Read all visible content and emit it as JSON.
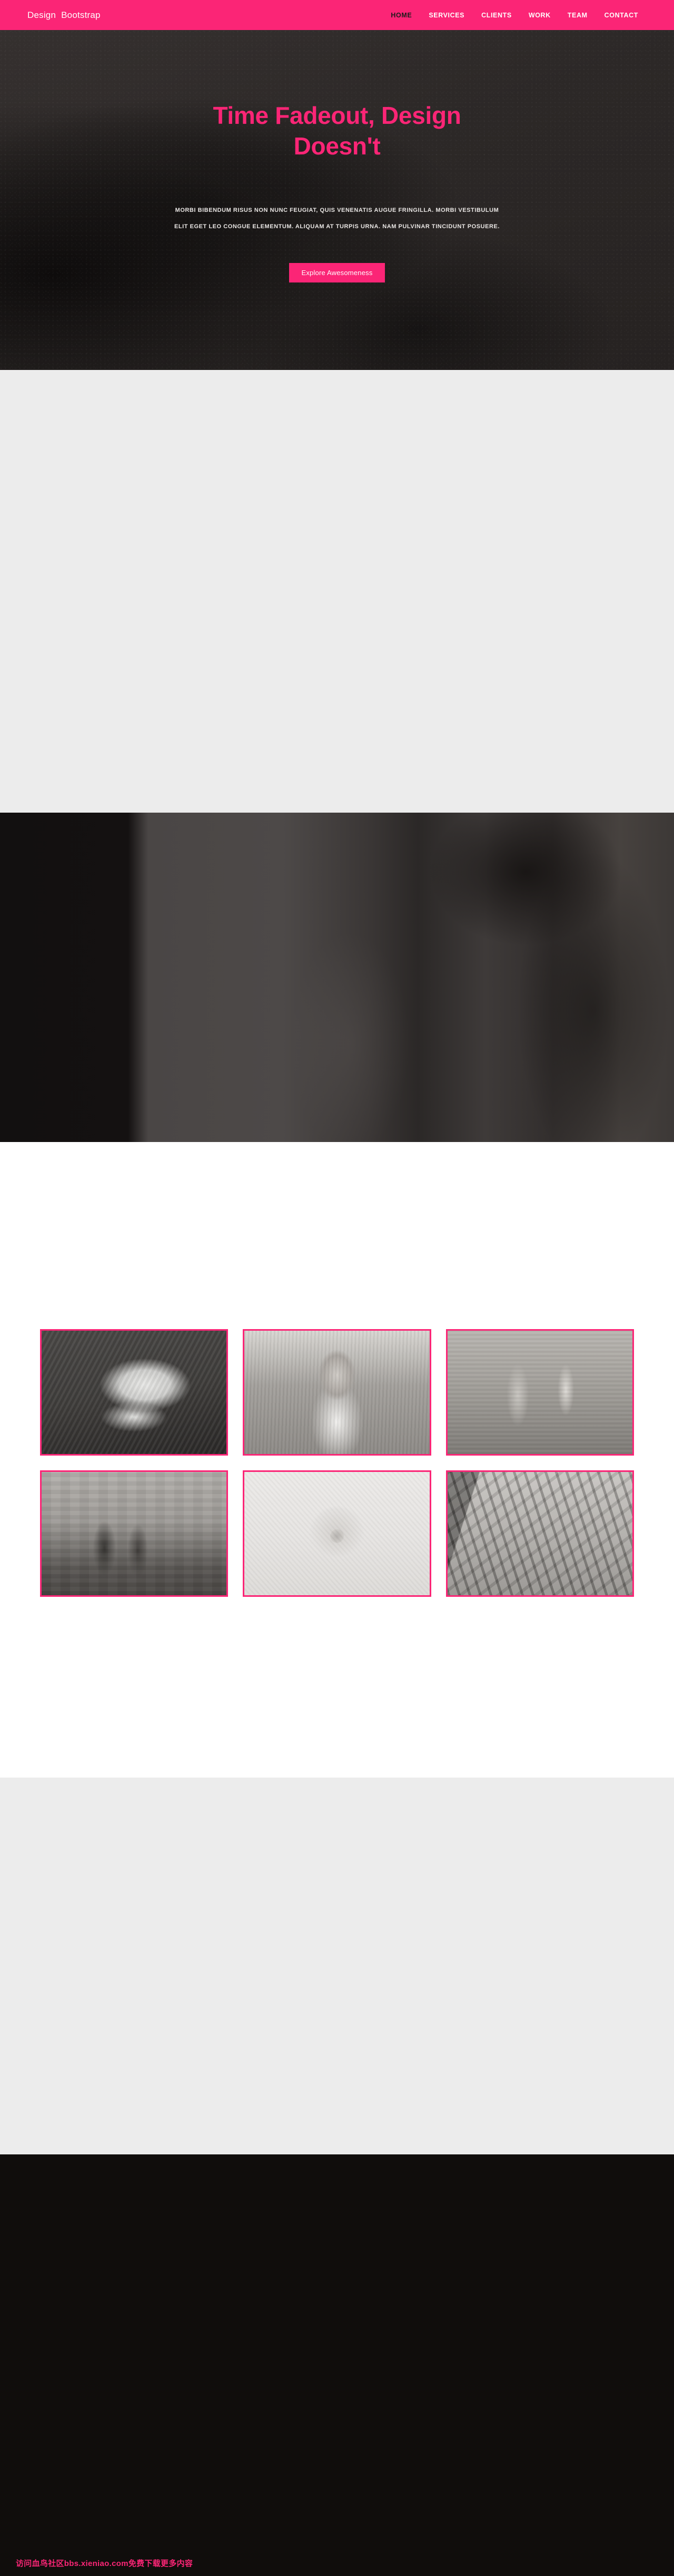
{
  "navbar": {
    "brand": {
      "part1": "Design",
      "part2": "Bootstrap"
    },
    "links": [
      {
        "label": "HOME",
        "active": true
      },
      {
        "label": "SERVICES",
        "active": false
      },
      {
        "label": "CLIENTS",
        "active": false
      },
      {
        "label": "WORK",
        "active": false
      },
      {
        "label": "TEAM",
        "active": false
      },
      {
        "label": "CONTACT",
        "active": false
      }
    ],
    "background_color": "#fb2576",
    "active_link_color": "#1a1a1a",
    "link_color": "#ffffff"
  },
  "hero": {
    "title": "Time Fadeout, Design Doesn't",
    "subtitle": "MORBI BIBENDUM RISUS NON NUNC FEUGIAT, QUIS VENENATIS AUGUE FRINGILLA. MORBI VESTIBULUM ELIT EGET LEO CONGUE ELEMENTUM. ALIQUAM AT TURPIS URNA. NAM PULVINAR TINCIDUNT POSUERE.",
    "button_label": "Explore Awesomeness",
    "title_color": "#fb2576",
    "background_color": "#2e2a29"
  },
  "sections": {
    "services": {
      "name": "services-section",
      "background_color": "#ececec"
    },
    "about": {
      "name": "about-parallax-section",
      "background_color": "#3a3635"
    },
    "work": {
      "name": "work-gallery-section",
      "background_color": "#ffffff"
    },
    "team": {
      "name": "team-section",
      "background_color": "#ececec"
    },
    "contact": {
      "name": "contact-section",
      "background_color": "#100d0c"
    }
  },
  "gallery": {
    "items": [
      {
        "name": "gallery-item-sneaker",
        "alt": "Grayscale sneaker shoe photo"
      },
      {
        "name": "gallery-item-portrait",
        "alt": "Grayscale portrait of a woman outdoors"
      },
      {
        "name": "gallery-item-chess",
        "alt": "Grayscale chess pieces on board"
      },
      {
        "name": "gallery-item-friends",
        "alt": "Grayscale photo of two girls on stairs"
      },
      {
        "name": "gallery-item-film-reel",
        "alt": "Grayscale film reel close-up"
      },
      {
        "name": "gallery-item-bridge",
        "alt": "Grayscale footbridge with shadows"
      }
    ],
    "border_color": "#fb2576"
  },
  "footer": {
    "note": "访问血鸟社区bbs.xieniao.com免费下载更多内容",
    "note_color": "#fb2576",
    "background_color": "#100d0c"
  }
}
